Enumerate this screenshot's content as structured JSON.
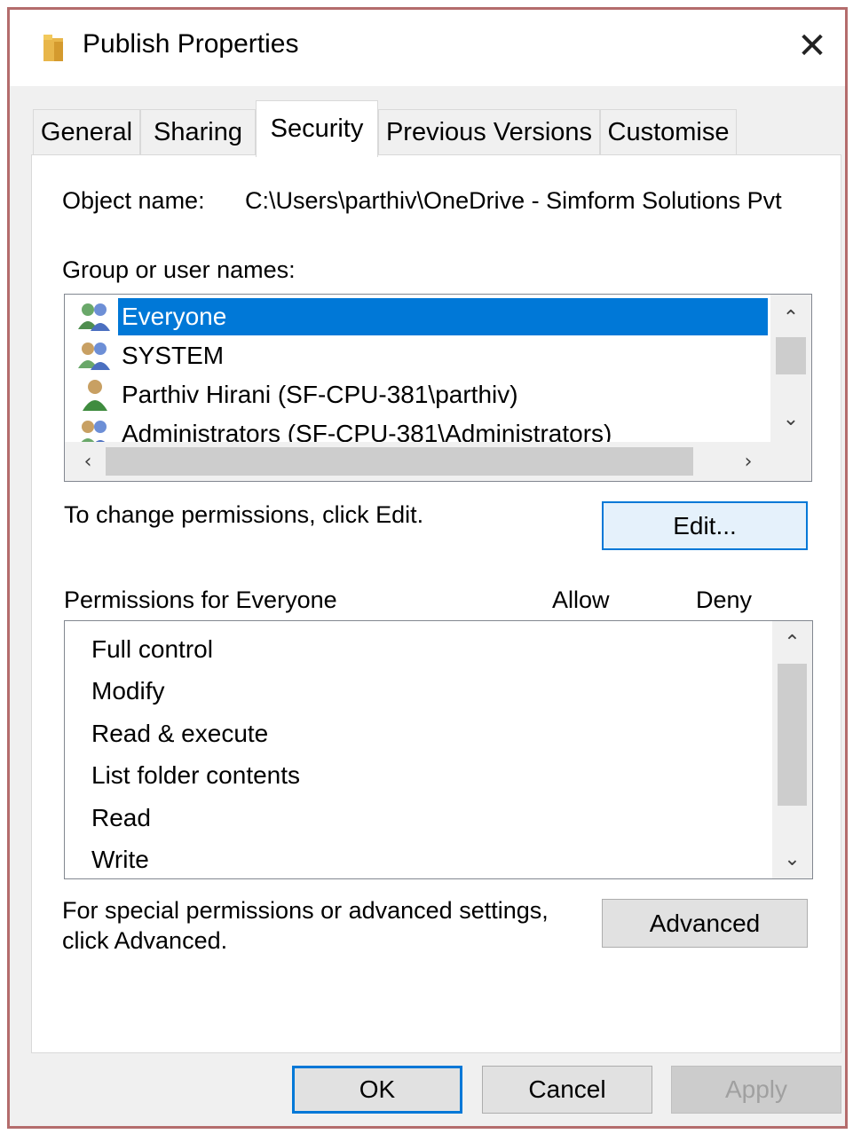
{
  "window": {
    "title": "Publish Properties",
    "close_symbol": "✕"
  },
  "tabs": [
    {
      "label": "General"
    },
    {
      "label": "Sharing"
    },
    {
      "label": "Security"
    },
    {
      "label": "Previous Versions"
    },
    {
      "label": "Customise"
    }
  ],
  "security": {
    "object_name_label": "Object name:",
    "object_name_value": "C:\\Users\\parthiv\\OneDrive - Simform Solutions Pvt",
    "group_label": "Group or user names:",
    "users": [
      {
        "name": "Everyone",
        "icon": "group-users-icon"
      },
      {
        "name": "SYSTEM",
        "icon": "group-users-icon"
      },
      {
        "name": "Parthiv Hirani (SF-CPU-381\\parthiv)",
        "icon": "user-icon"
      },
      {
        "name": "Administrators (SF-CPU-381\\Administrators)",
        "icon": "group-users-icon"
      }
    ],
    "change_hint": "To change permissions, click Edit.",
    "edit_label": "Edit...",
    "permissions_for_label": "Permissions for Everyone",
    "allow_label": "Allow",
    "deny_label": "Deny",
    "permissions": [
      {
        "name": "Full control"
      },
      {
        "name": "Modify"
      },
      {
        "name": "Read & execute"
      },
      {
        "name": "List folder contents"
      },
      {
        "name": "Read"
      },
      {
        "name": "Write"
      }
    ],
    "advanced_hint_line1": "For special permissions or advanced settings,",
    "advanced_hint_line2": "click Advanced.",
    "advanced_label": "Advanced"
  },
  "footer": {
    "ok_label": "OK",
    "cancel_label": "Cancel",
    "apply_label": "Apply"
  },
  "colors": {
    "selection": "#0078d7",
    "frame_border": "#b46c6c"
  }
}
